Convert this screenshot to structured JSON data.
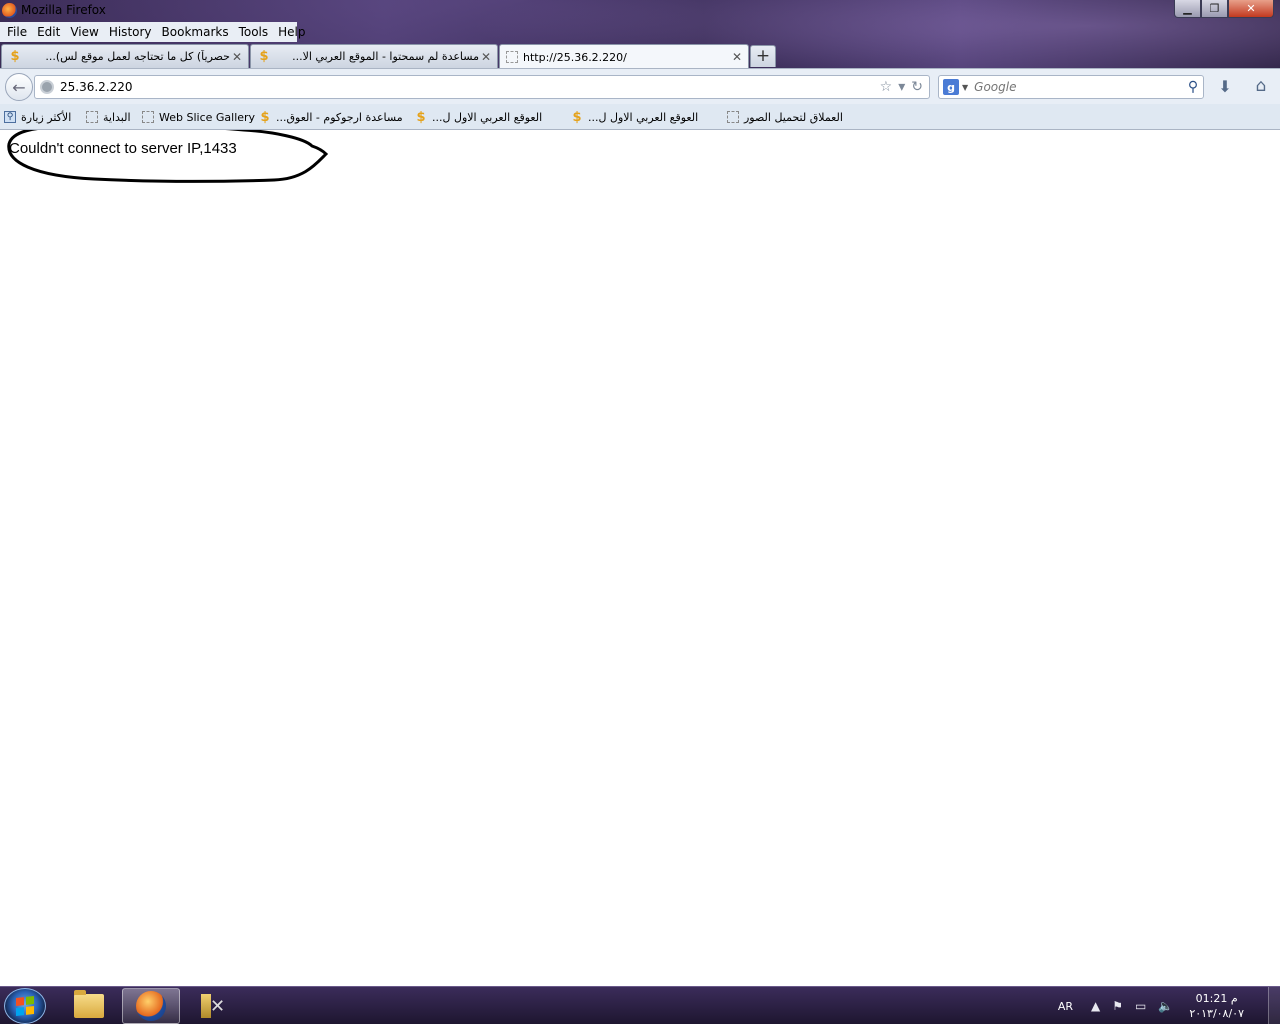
{
  "window": {
    "title": "Mozilla Firefox",
    "min": "▁",
    "max": "❐",
    "close": "✕"
  },
  "menu": [
    "File",
    "Edit",
    "View",
    "History",
    "Bookmarks",
    "Tools",
    "Help"
  ],
  "tabs": [
    {
      "label": "حصرياً) كل ما تحتاجه لعمل موقع لس)...",
      "icon": "dollar-favicon"
    },
    {
      "label": "مساعدة لم سمحتوا - الموقع العربي الا...",
      "icon": "dollar-favicon"
    },
    {
      "label": "http://25.36.2.220/",
      "icon": "blank-favicon"
    }
  ],
  "navbar": {
    "url": "25.36.2.220",
    "search_placeholder": "Google",
    "search_engine_letter": "g"
  },
  "bookmarks": [
    {
      "label": "الأكثر زيارة",
      "icon": "smart-bookmark"
    },
    {
      "label": "البداية",
      "icon": "blank"
    },
    {
      "label": "Web Slice Gallery",
      "icon": "blank"
    },
    {
      "label": "مساعدة ارجوكوم - العوق...",
      "icon": "dollar"
    },
    {
      "label": "العوقع العربي الاول ل...",
      "icon": "dollar"
    },
    {
      "label": "العوقع العربي الاول ل...",
      "icon": "dollar"
    },
    {
      "label": "العملاق لتحميل الصور",
      "icon": "blank"
    }
  ],
  "content": {
    "error_message": "Couldn't connect to server IP,1433"
  },
  "taskbar": {
    "language": "AR",
    "time": "م 01:21",
    "date": "٢٠١٣/٠٨/٠٧"
  },
  "colors": {
    "favicon_dollar": "#e5a21a",
    "taskbar_bg": "#1e1630"
  }
}
